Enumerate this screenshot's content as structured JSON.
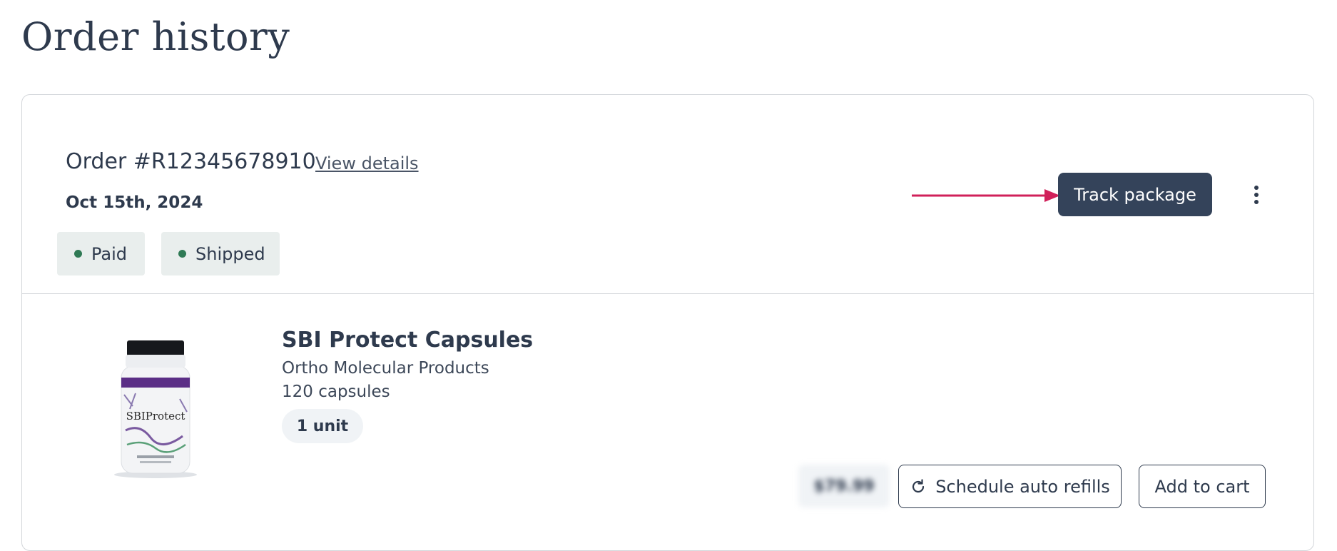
{
  "page": {
    "title": "Order history"
  },
  "order": {
    "number": "Order #R12345678910",
    "view_details_label": "View details",
    "date": "Oct 15th, 2024",
    "badges": [
      {
        "label": "Paid",
        "dot_color": "#2f7a55"
      },
      {
        "label": "Shipped",
        "dot_color": "#2f7a55"
      }
    ],
    "track_label": "Track package",
    "more_icon": "vertical-ellipsis-icon",
    "annotation_arrow_color": "#d0205a"
  },
  "product": {
    "name": "SBI Protect Capsules",
    "brand": "Ortho Molecular Products",
    "size": "120 capsules",
    "quantity": "1 unit",
    "price": "$79.99",
    "image_text": "SBIProtect",
    "refill_label": "Schedule auto refills",
    "refill_icon": "refresh-icon",
    "cart_label": "Add to cart"
  },
  "colors": {
    "primary": "#34435a",
    "text": "#2e3a4d",
    "badge_bg": "#e9eeed",
    "status_green": "#2f7a55"
  }
}
